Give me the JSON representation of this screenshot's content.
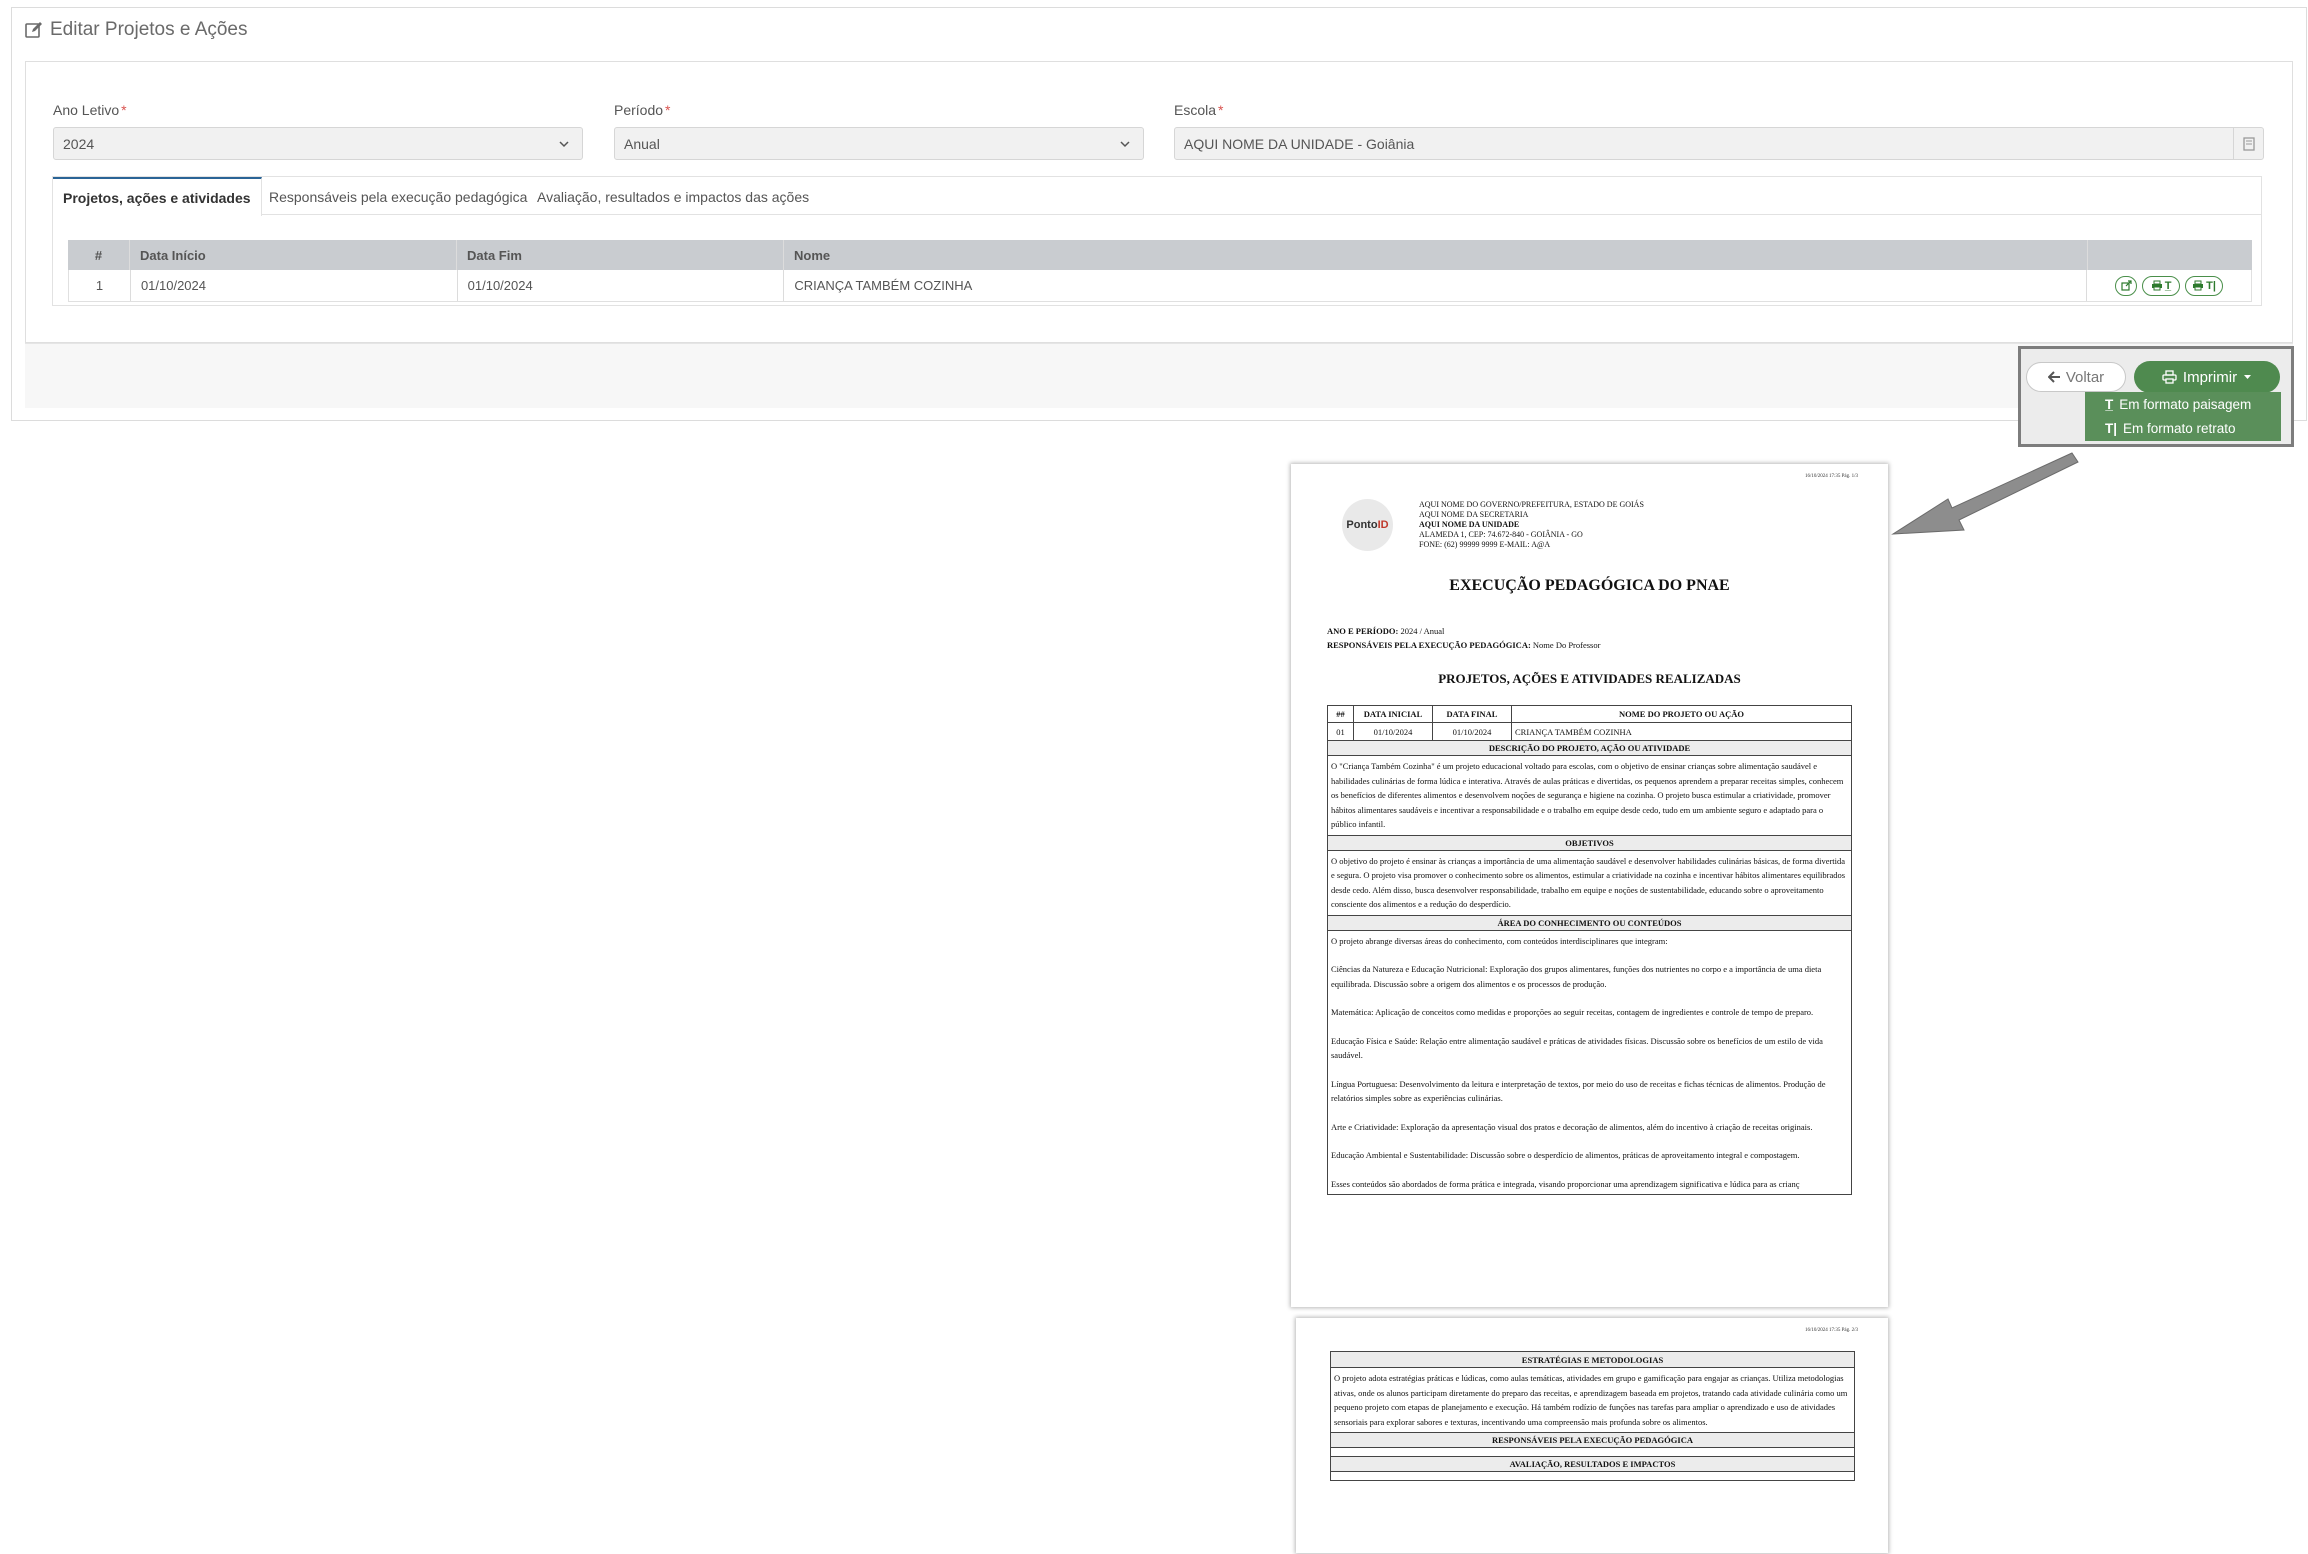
{
  "page": {
    "title": "Editar Projetos e Ações",
    "title_icon": "edit-icon"
  },
  "form": {
    "ano_letivo": {
      "label": "Ano Letivo",
      "required": "*",
      "value": "2024"
    },
    "periodo": {
      "label": "Período",
      "required": "*",
      "value": "Anual"
    },
    "escola": {
      "label": "Escola",
      "required": "*",
      "value": "AQUI NOME DA UNIDADE - Goiânia"
    }
  },
  "tabs": [
    {
      "label": "Projetos, ações e atividades",
      "active": true
    },
    {
      "label": "Responsáveis pela execução pedagógica",
      "active": false
    },
    {
      "label": "Avaliação, resultados e impactos das ações",
      "active": false
    }
  ],
  "grid": {
    "headers": [
      "#",
      "Data Início",
      "Data Fim",
      "Nome",
      ""
    ],
    "rows": [
      {
        "n": "1",
        "inicio": "01/10/2024",
        "fim": "01/10/2024",
        "nome": "CRIANÇA TAMBÉM COZINHA"
      }
    ],
    "row_actions": [
      "share-icon",
      "print-landscape-icon",
      "print-portrait-icon"
    ]
  },
  "footer": {
    "voltar_label": "Voltar",
    "imprimir_label": "Imprimir",
    "menu": [
      {
        "label": "Em formato paisagem",
        "icon": "landscape-text-icon"
      },
      {
        "label": "Em formato retrato",
        "icon": "portrait-text-icon"
      }
    ]
  },
  "colors": {
    "accent_green": "#4f8a4f",
    "menu_green": "#5a8f5a",
    "grid_header": "#c9ccd0",
    "tab_active_border": "#2a6496",
    "required": "#d9534f"
  },
  "preview": {
    "page1": {
      "timestamp": "16/10/2024 17:35   Pág. 1/3",
      "logo_text": "Ponto",
      "logo_accent": "ID",
      "header_lines": [
        "AQUI NOME DO GOVERNO/PREFEITURA, ESTADO DE GOIÁS",
        "AQUI NOME DA SECRETARIA",
        "AQUI NOME DA UNIDADE",
        "ALAMEDA 1, CEP: 74.672-840 - GOIÂNIA - GO",
        "FONE: (62) 99999 9999 E-MAIL: A@A"
      ],
      "title": "EXECUÇÃO PEDAGÓGICA DO PNAE",
      "ano_label": "ANO E PERÍODO:",
      "ano_value": "2024 / Anual",
      "resp_label": "RESPONSÁVEIS PELA EXECUÇÃO PEDAGÓGICA:",
      "resp_value": "Nome Do Professor",
      "section_title": "PROJETOS, AÇÕES E ATIVIDADES REALIZADAS",
      "table_headers": [
        "##",
        "DATA INICIAL",
        "DATA FINAL",
        "NOME DO PROJETO OU AÇÃO"
      ],
      "table_row": [
        "01",
        "01/10/2024",
        "01/10/2024",
        "CRIANÇA TAMBÉM COZINHA"
      ],
      "desc_title": "DESCRIÇÃO DO PROJETO, AÇÃO OU ATIVIDADE",
      "desc_text": "O \"Criança Também Cozinha\" é um projeto educacional voltado para escolas, com o objetivo de ensinar crianças sobre alimentação saudável e habilidades culinárias de forma lúdica e interativa. Através de aulas práticas e divertidas, os pequenos aprendem a preparar receitas simples, conhecem os benefícios de diferentes alimentos e desenvolvem noções de segurança e higiene na cozinha. O projeto busca estimular a criatividade, promover hábitos alimentares saudáveis e incentivar a responsabilidade e o trabalho em equipe desde cedo, tudo em um ambiente seguro e adaptado para o público infantil.",
      "obj_title": "OBJETIVOS",
      "obj_text": "O objetivo do projeto é ensinar às crianças a importância de uma alimentação saudável e desenvolver habilidades culinárias básicas, de forma divertida e segura. O projeto visa promover o conhecimento sobre os alimentos, estimular a criatividade na cozinha e incentivar hábitos alimentares equilibrados desde cedo. Além disso, busca desenvolver responsabilidade, trabalho em equipe e noções de sustentabilidade, educando sobre o aproveitamento consciente dos alimentos e a redução do desperdício.",
      "area_title": "ÁREA DO CONHECIMENTO OU CONTEÚDOS",
      "area_paragraphs": [
        "O projeto abrange diversas áreas do conhecimento, com conteúdos interdisciplinares que integram:",
        "Ciências da Natureza e Educação Nutricional: Exploração dos grupos alimentares, funções dos nutrientes no corpo e a importância de uma dieta equilibrada. Discussão sobre a origem dos alimentos e os processos de produção.",
        "Matemática: Aplicação de conceitos como medidas e proporções ao seguir receitas, contagem de ingredientes e controle de tempo de preparo.",
        "Educação Física e Saúde: Relação entre alimentação saudável e práticas de atividades físicas. Discussão sobre os benefícios de um estilo de vida saudável.",
        "Língua Portuguesa: Desenvolvimento da leitura e interpretação de textos, por meio do uso de receitas e fichas técnicas de alimentos. Produção de relatórios simples sobre as experiências culinárias.",
        "Arte e Criatividade: Exploração da apresentação visual dos pratos e decoração de alimentos, além do incentivo à criação de receitas originais.",
        "Educação Ambiental e Sustentabilidade: Discussão sobre o desperdício de alimentos, práticas de aproveitamento integral e compostagem.",
        "Esses conteúdos são abordados de forma prática e integrada, visando proporcionar uma aprendizagem significativa e lúdica para as crianç"
      ]
    },
    "page2": {
      "timestamp": "16/10/2024 17:35   Pág. 2/3",
      "estrat_title": "ESTRATÉGIAS E METODOLOGIAS",
      "estrat_text": "O projeto adota estratégias práticas e lúdicas, como aulas temáticas, atividades em grupo e gamificação para engajar as crianças. Utiliza metodologias ativas, onde os alunos participam diretamente do preparo das receitas, e aprendizagem baseada em projetos, tratando cada atividade culinária como um pequeno projeto com etapas de planejamento e execução. Há também rodízio de funções nas tarefas para ampliar o aprendizado e uso de atividades sensoriais para explorar sabores e texturas, incentivando uma compreensão mais profunda sobre os alimentos.",
      "resp_title": "RESPONSÁVEIS PELA EXECUÇÃO PEDAGÓGICA",
      "aval_title": "AVALIAÇÃO, RESULTADOS E IMPACTOS"
    }
  }
}
